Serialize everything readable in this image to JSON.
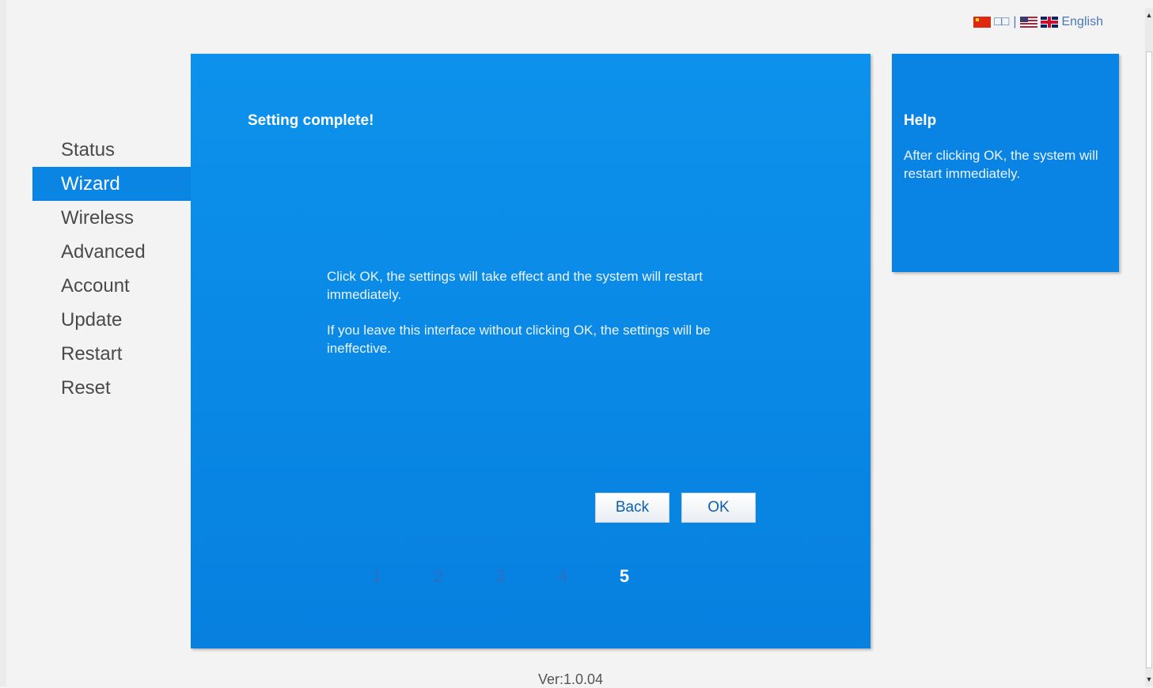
{
  "language_bar": {
    "chinese_label": "□□",
    "separator": "|",
    "english_label": "English"
  },
  "sidebar": {
    "items": [
      {
        "label": "Status"
      },
      {
        "label": "Wizard"
      },
      {
        "label": "Wireless"
      },
      {
        "label": "Advanced"
      },
      {
        "label": "Account"
      },
      {
        "label": "Update"
      },
      {
        "label": "Restart"
      },
      {
        "label": "Reset"
      }
    ],
    "active": "Wizard"
  },
  "main": {
    "title": "Setting complete!",
    "message_1": "Click OK, the settings will take effect and the system will restart immediately.",
    "message_2": "If you leave this interface without clicking OK, the settings will be ineffective.",
    "back_label": "Back",
    "ok_label": "OK",
    "steps": [
      "1",
      "2",
      "3",
      "4",
      "5"
    ],
    "current_step": "5"
  },
  "help": {
    "title": "Help",
    "text": "After clicking OK, the system will restart immediately."
  },
  "footer": {
    "version": "Ver:1.0.04"
  },
  "colors": {
    "accent": "#0b85e3",
    "panel": "#0c8ae8",
    "background": "#f3f3f3"
  }
}
